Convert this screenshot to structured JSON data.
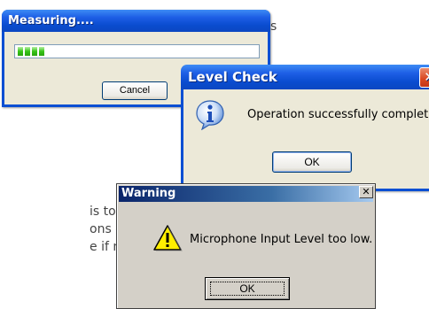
{
  "background": {
    "fragment_s": "s",
    "lines": [
      "is too",
      "ons of",
      "e if needed"
    ]
  },
  "measuring": {
    "title": "Measuring....",
    "progress": 0.12,
    "cancel_label": "Cancel"
  },
  "level_check": {
    "title": "Level Check",
    "message": "Operation successfully completed",
    "ok_label": "OK",
    "close_label": "✕",
    "icon": "info-icon"
  },
  "warning": {
    "title": "Warning",
    "message": "Microphone Input Level too low.",
    "ok_label": "OK",
    "close_label": "✕",
    "icon": "warning-icon"
  },
  "colors": {
    "xp_titlebar": "#0a4fd3",
    "close_button": "#d9451f",
    "dialog_face": "#ece9d8",
    "classic_face": "#d4d0c8",
    "progress_green": "#37c418"
  }
}
